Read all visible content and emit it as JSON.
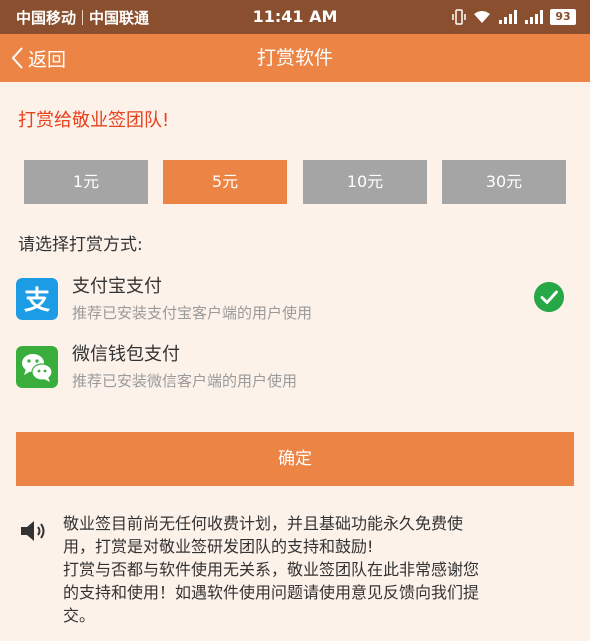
{
  "status_bar": {
    "carrier_1": "中国移动",
    "carrier_2": "中国联通",
    "time": "11:41 AM",
    "battery": "93"
  },
  "nav": {
    "back_label": "返回",
    "title": "打赏软件"
  },
  "heading": "打赏给敬业签团队!",
  "amounts": [
    {
      "label": "1元",
      "selected": false
    },
    {
      "label": "5元",
      "selected": true
    },
    {
      "label": "10元",
      "selected": false
    },
    {
      "label": "30元",
      "selected": false
    }
  ],
  "payment": {
    "label": "请选择打赏方式:",
    "options": [
      {
        "name": "支付宝支付",
        "desc": "推荐已安装支付宝客户端的用户使用",
        "selected": true,
        "icon": "alipay-icon"
      },
      {
        "name": "微信钱包支付",
        "desc": "推荐已安装微信客户端的用户使用",
        "selected": false,
        "icon": "wechat-icon"
      }
    ]
  },
  "confirm_label": "确定",
  "notice": {
    "lines": [
      "敬业签目前尚无任何收费计划，并且基础功能永久免费使",
      "用，打赏是对敬业签研发团队的支持和鼓励!",
      "打赏与否都与软件使用无关系，敬业签团队在此非常感谢您",
      "的支持和使用！如遇软件使用问题请使用意见反馈向我们提",
      "交。"
    ]
  },
  "colors": {
    "accent": "#ec8446",
    "status_bar": "#8a4f2f",
    "heading": "#e8411c",
    "unselected_button": "#a5a5a5",
    "check": "#27a847",
    "alipay": "#1b9ce5",
    "wechat": "#3aae3c",
    "background": "#fdf2ea"
  }
}
